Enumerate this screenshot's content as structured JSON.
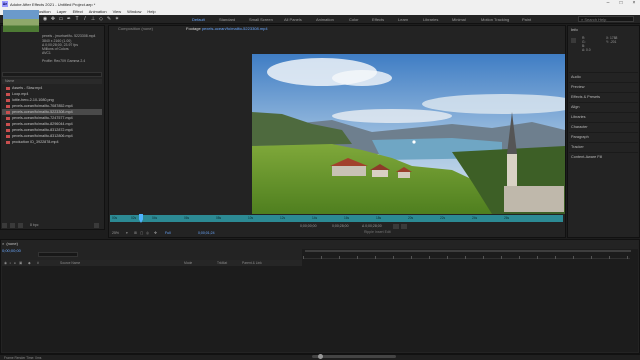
{
  "window": {
    "title": "Adobe After Effects 2021 - Untitled Project.aep *",
    "app_icon_text": "Ae"
  },
  "menu": [
    "File",
    "Edit",
    "Composition",
    "Layer",
    "Effect",
    "Animation",
    "View",
    "Window",
    "Help"
  ],
  "workspaces": [
    "Default",
    "Standard",
    "Small Screen",
    "All Panels",
    "Animation",
    "Color",
    "Effects",
    "Learn",
    "Libraries",
    "Minimal",
    "Motion Tracking",
    "Paint"
  ],
  "search_help_placeholder": "Search Help",
  "project": {
    "title": "Project",
    "selected_name": "pexels - jmurhart/fo- 5223308.mp4",
    "info_lines": [
      "3840 x 2160 (1.00)",
      "Δ 0;00;28;00, 23.97 fps",
      "Millions of Colors",
      "AVC1"
    ],
    "profile": "Profile: Rec709 Gamma 2.4",
    "col_name": "Name",
    "files": [
      {
        "name": "Assets - Slow.mp4",
        "color": "#c94f4f"
      },
      {
        "name": "Loop.mp4",
        "color": "#c94f4f"
      },
      {
        "name": "lottie-hero-2-10-1080.png",
        "color": "#c94f4f"
      },
      {
        "name": "pexels-ocean/fo/mailto-7087852.mp4",
        "color": "#c94f4f"
      },
      {
        "name": "pexels-ocean/fo/mailto-5223308.mp4",
        "color": "#c94f4f",
        "selected": true
      },
      {
        "name": "pexels-ocean/fo/mailto-7247577.mp4",
        "color": "#c94f4f"
      },
      {
        "name": "pexels-ocean/fo/mailto-8296044.mp4",
        "color": "#c94f4f"
      },
      {
        "name": "pexels-ocean/fo/mailto-8312872.mp4",
        "color": "#c94f4f"
      },
      {
        "name": "pexels-ocean/fo/mailto-8312806.mp4",
        "color": "#c94f4f"
      },
      {
        "name": "production ID_3922878.mp4",
        "color": "#c94f4f"
      }
    ],
    "bottom_bpc": "8 bpc"
  },
  "viewer": {
    "tab_composition": "Composition (none)",
    "tab_footage_prefix": "Footage",
    "tab_footage_name": "pexels-ocean/fo/mailto-5223308.mp4",
    "ruler_ticks": [
      "00s",
      "02s",
      "04s",
      "06s",
      "08s",
      "10s",
      "12s",
      "14s",
      "16s",
      "18s",
      "20s",
      "22s",
      "24s",
      "26s"
    ],
    "in_point": "0;00;00;00",
    "out_point": "0;00;28;00",
    "duration": "Δ 0;00;28;00",
    "ripple_label": "Ripple Insert Edit",
    "zoom": "25%",
    "resolution": "Full",
    "current_time": "0;00;01;24"
  },
  "info": {
    "title": "Info",
    "r": "R:",
    "g": "G:",
    "b": "B:",
    "a": "A: 0.0",
    "x": "X: 1788",
    "y": "Y: -201"
  },
  "right_panels": [
    "Audio",
    "Preview",
    "Effects & Presets",
    "Align",
    "Libraries",
    "Character",
    "Paragraph",
    "Tracker",
    "Content-Aware Fill"
  ],
  "timeline": {
    "tab": "(none)",
    "time": "0;00;00;00",
    "col_source": "Source Name",
    "col_mode": "Mode",
    "col_trkmat": "TrkMat",
    "col_parent": "Parent & Link",
    "bottom_left": "Frame Render Time: 0ms"
  }
}
